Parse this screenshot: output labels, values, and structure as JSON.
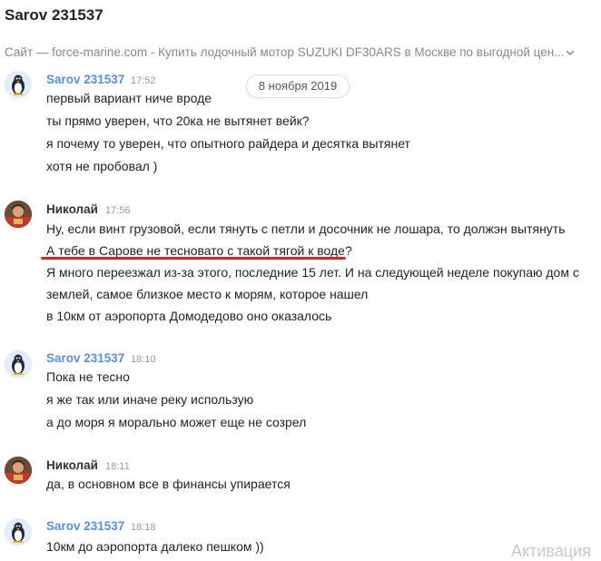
{
  "header": {
    "title": "Sarov 231537",
    "site_preview": "Сайт — force-marine.com - Купить лодочный мотор SUZUKI DF30ARS в Москве по выгодной цен..."
  },
  "date_separator": "8 ноября 2019",
  "messages": [
    {
      "author": "Sarov 231537",
      "time": "17:52",
      "lines": [
        "первый вариант ниче вроде",
        "ты прямо уверен, что 20ка не вытянет вейк?",
        "я почему то уверен, что опытного райдера и десятка вытянет",
        "хотя не пробовал )"
      ]
    },
    {
      "author": "Николай",
      "time": "17:56",
      "lines": [
        "Ну, если винт грузовой, если тянуть с петли и досочник не лошара, то должэн вытянуть",
        "А тебе в Сарове не тесновато с такой тягой к воде?",
        "Я много переезжал из-за этого, последние 15 лет. И на следующей неделе покупаю дом с",
        "землей, самое близкое место к морям, которое нашел",
        "в 10км от аэропорта Домодедово оно оказалось"
      ]
    },
    {
      "author": "Sarov 231537",
      "time": "18:10",
      "lines": [
        "Пока не тесно",
        "я же так или иначе реку использую",
        "а до моря я морально может еще не созрел"
      ]
    },
    {
      "author": "Николай",
      "time": "18:11",
      "lines": [
        "да, в основном все в финансы упирается"
      ]
    },
    {
      "author": "Sarov 231537",
      "time": "18:18",
      "lines": [
        "10км до аэропорта далеко пешком ))"
      ]
    }
  ],
  "watermark": "Активация",
  "colors": {
    "sarov_name": "#5b8fcf",
    "highlight_underline": "#d42525"
  }
}
